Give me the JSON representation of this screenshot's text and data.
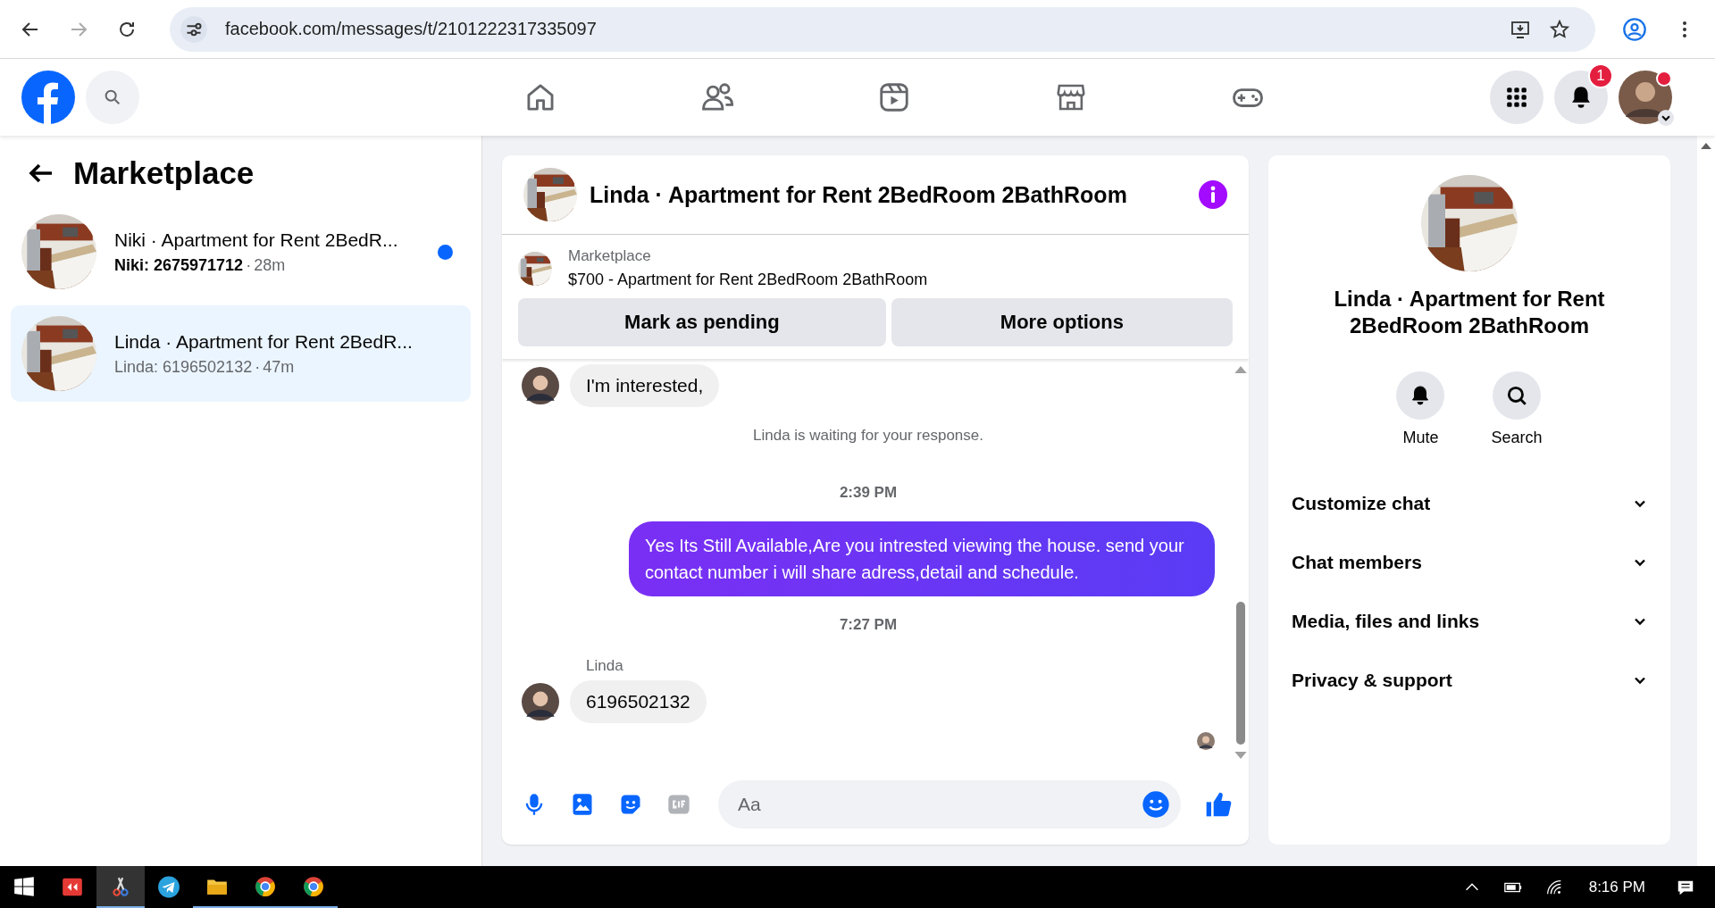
{
  "browser": {
    "url": "facebook.com/messages/t/2101222317335097"
  },
  "header": {
    "notifications_badge": "1"
  },
  "sidebar": {
    "title": "Marketplace",
    "conversations": [
      {
        "title": "Niki · Apartment for Rent 2BedR...",
        "preview": "Niki: 2675971712",
        "separator": "·",
        "time": "28m",
        "unread": true,
        "selected": false
      },
      {
        "title": "Linda · Apartment for Rent 2BedR...",
        "preview": "Linda: 6196502132",
        "separator": "·",
        "time": "47m",
        "unread": false,
        "selected": true
      }
    ]
  },
  "chat": {
    "title": "Linda · Apartment for Rent 2BedRoom 2BathRoom",
    "listing": {
      "source": "Marketplace",
      "name": "$700 - Apartment for Rent 2BedRoom 2BathRoom"
    },
    "actions": [
      "Mark as pending",
      "More options"
    ],
    "messages": [
      {
        "kind": "incoming",
        "text": "I'm interested,"
      },
      {
        "kind": "notice",
        "text": "Linda is waiting for your response."
      },
      {
        "kind": "time",
        "text": "2:39 PM"
      },
      {
        "kind": "outgoing",
        "text": "Yes Its Still Available,Are you intrested viewing the house. send your contact number i will share adress,detail and schedule."
      },
      {
        "kind": "time",
        "text": "7:27 PM"
      },
      {
        "kind": "sender",
        "text": "Linda"
      },
      {
        "kind": "incoming",
        "text": "6196502132"
      }
    ],
    "composer": {
      "placeholder": "Aa"
    }
  },
  "details": {
    "title": "Linda · Apartment for Rent 2BedRoom 2BathRoom",
    "actions": [
      "Mute",
      "Search"
    ],
    "sections": [
      "Customize chat",
      "Chat members",
      "Media, files and links",
      "Privacy & support"
    ]
  },
  "taskbar": {
    "time": "8:16 PM"
  }
}
